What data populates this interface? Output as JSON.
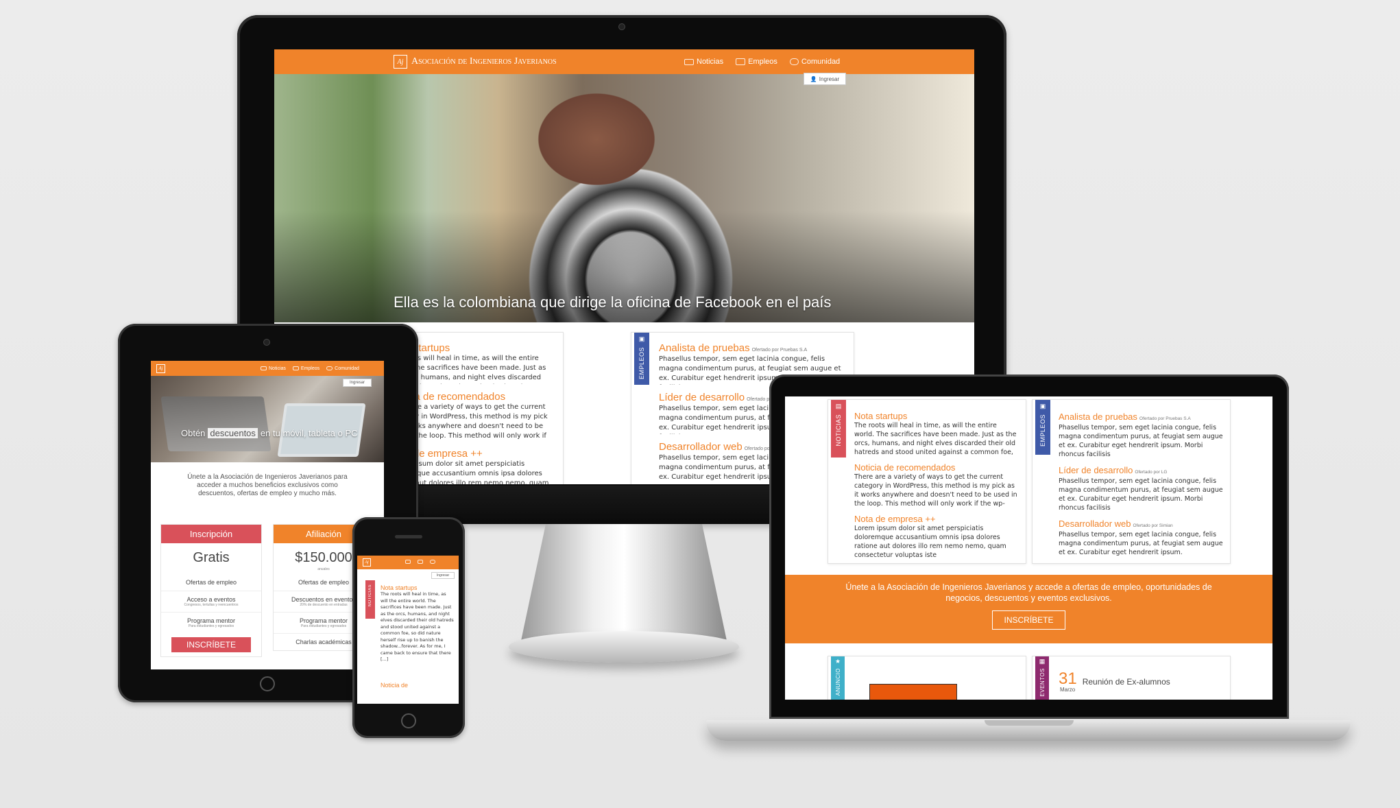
{
  "site": {
    "logo_mark": "Aj",
    "brand": "Asociación de Ingenieros Javerianos",
    "nav": [
      "Noticias",
      "Empleos",
      "Comunidad"
    ],
    "login": "Ingresar",
    "accent_color": "#f0832a"
  },
  "desktop": {
    "hero_caption": "Ella es la colombiana que dirige la oficina de Facebook en el país"
  },
  "sections": {
    "news_label": "NOTICIAS",
    "jobs_label": "EMPLEOS",
    "announce_label": "ANUNCIO",
    "events_label": "EVENTOS"
  },
  "news": [
    {
      "title": "Nota startups",
      "body": "The roots will heal in time, as will the entire world. The sacrifices have been made. Just as the orcs, humans, and night elves discarded their old hatreds and stood united against a common foe, so did nature herself rise up to banish the shadow...forever."
    },
    {
      "title": "Noticia de recomendados",
      "body": "There are a variety of ways to get the current category in WordPress, this method is my pick as it works anywhere and doesn't need to be used in the loop. This method will only work if the wp-query is setup"
    },
    {
      "title": "Nota de empresa ++",
      "body": "Lorem ipsum dolor sit amet perspiciatis doloremque accusantium omnis ipsa dolores ratione aut dolores illo rem nemo nemo, quam consectetur voluptas iste"
    }
  ],
  "jobs": [
    {
      "title": "Analista de pruebas",
      "by": "Ofertado por Pruebas S.A",
      "body": "Phasellus tempor, sem eget lacinia congue, felis magna condimentum purus, at feugiat sem augue et ex. Curabitur eget hendrerit ipsum. Morbi rhoncus facilisis"
    },
    {
      "title": "Líder de desarrollo",
      "by": "Ofertado por LG",
      "body": "Phasellus tempor, sem eget lacinia congue, felis magna condimentum purus, at feugiat sem augue et ex. Curabitur eget hendrerit ipsum. Morbi rhoncus facilisis"
    },
    {
      "title": "Desarrollador web",
      "by": "Ofertado por Simian",
      "body": "Phasellus tempor, sem eget lacinia congue, felis magna condimentum purus, at feugiat sem augue et ex. Curabitur eget hendrerit ipsum."
    }
  ],
  "laptop": {
    "join_text": "Únete a la Asociación de Ingenieros Javerianos y accede a ofertas de empleo, oportunidades de negocios, descuentos y eventos exclusivos.",
    "cta": "INSCRÍBETE",
    "event_day": "31",
    "event_month": "Marzo",
    "event_title": "Reunión de Ex-alumnos"
  },
  "tablet": {
    "caption_pre": "Obtén",
    "caption_hl": "descuentos",
    "caption_post": "en tu móvil, tableta o PC",
    "intro": "Únete a la Asociación de Ingenieros Javerianos para acceder a muchos beneficios exclusivos como descuentos, ofertas de empleo y mucho más.",
    "plans": [
      {
        "name": "Inscripción",
        "price": "Gratis",
        "price_note": "",
        "color": "#d9515a",
        "rows": [
          {
            "label": "Ofertas de empleo",
            "note": ""
          },
          {
            "label": "Acceso a eventos",
            "note": "Congresos, tertulias y reencuentros"
          },
          {
            "label": "Programa mentor",
            "note": "Para estudiantes y egresados"
          }
        ],
        "cta": "INSCRÍBETE"
      },
      {
        "name": "Afiliación",
        "price": "$150.000",
        "price_note": "anuales",
        "color": "#f0832a",
        "rows": [
          {
            "label": "Ofertas de empleo",
            "note": ""
          },
          {
            "label": "Descuentos en eventos",
            "note": "20% de descuento en entradas"
          },
          {
            "label": "Programa mentor",
            "note": "Para estudiantes y egresados"
          },
          {
            "label": "Charlas académicas",
            "note": ""
          }
        ],
        "cta": ""
      }
    ]
  },
  "phone": {
    "news_title": "Nota startups",
    "news_body": "The roots will heal in time, as will the entire world. The sacrifices have been made. Just as the orcs, humans, and night elves discarded their old hatreds and stood united against a common foe, so did nature herself rise up to banish the shadow...forever. As for me, I came back to ensure that there [...]",
    "next_title": "Noticia de"
  },
  "colors": {
    "news_ribbon": "#d9515a",
    "jobs_ribbon": "#3f5aa8",
    "announce_ribbon": "#3fb0c9",
    "events_ribbon": "#8e2a6e"
  }
}
